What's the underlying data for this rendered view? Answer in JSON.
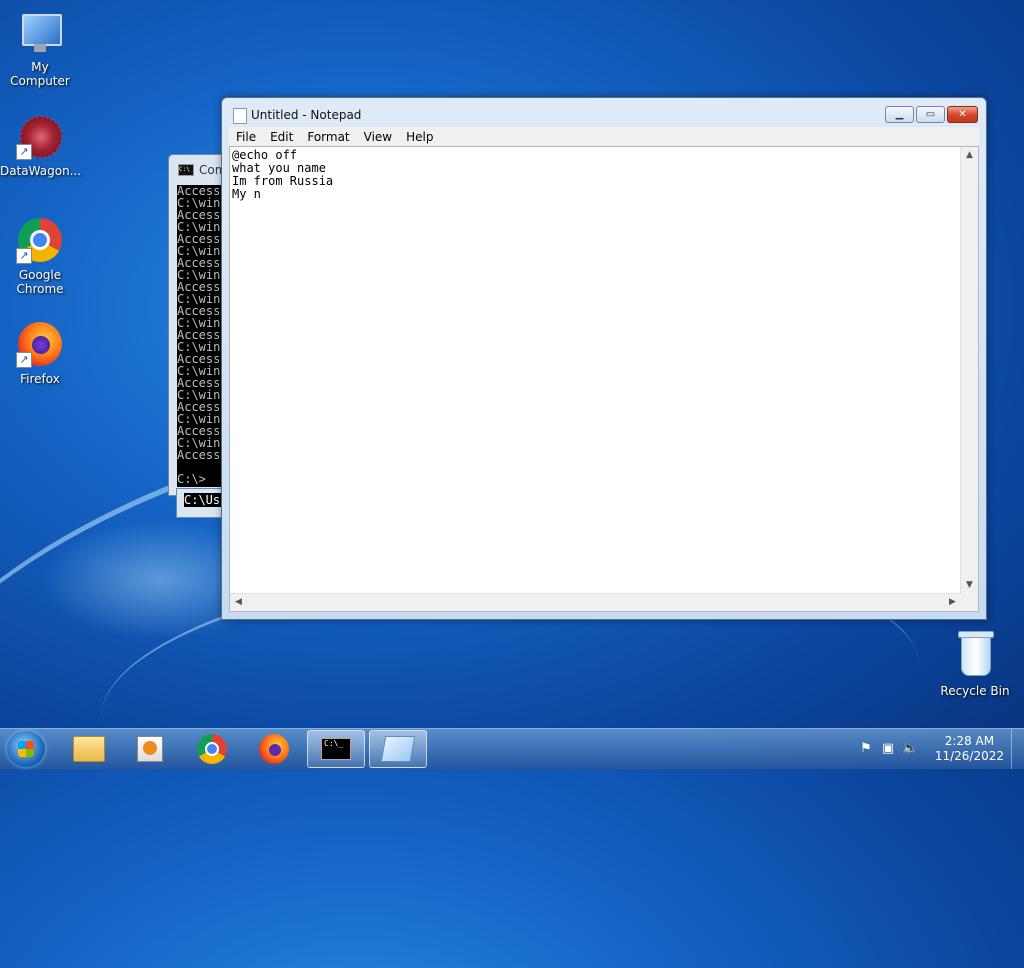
{
  "desktop": {
    "icons": [
      {
        "label": "My Computer",
        "icon": "computer-icon"
      },
      {
        "label": "DataWagon...",
        "icon": "datawagon-icon"
      },
      {
        "label": "Google Chrome",
        "icon": "chrome-icon"
      },
      {
        "label": "Firefox",
        "icon": "firefox-icon"
      },
      {
        "label": "Recycle Bin",
        "icon": "recycle-bin-icon"
      }
    ]
  },
  "cmd": {
    "title": "Com",
    "lines": "Access\nC:\\win\nAccess\nC:\\win\nAccess\nC:\\win\nAccess\nC:\\win\nAccess\nC:\\win\nAccess\nC:\\win\nAccess\nC:\\win\nAccess\nC:\\win\nAccess\nC:\\win\nAccess\nC:\\win\nAccess\nC:\\win\nAccess\n\nC:\\>",
    "second_line": "C:\\Us"
  },
  "notepad": {
    "title": "Untitled - Notepad",
    "menu": {
      "file": "File",
      "edit": "Edit",
      "format": "Format",
      "view": "View",
      "help": "Help"
    },
    "content": "@echo off\nwhat you name\nIm from Russia\nMy n"
  },
  "taskbar": {
    "clock_time": "2:28 AM",
    "clock_date": "11/26/2022",
    "cmd_label": "C:\\_"
  },
  "colors": {
    "desktop_blue": "#1565c6",
    "close_red": "#d2462c"
  }
}
